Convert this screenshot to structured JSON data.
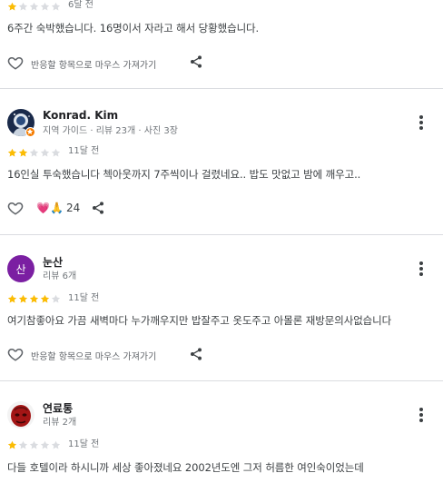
{
  "reviews": [
    {
      "rating": 1,
      "date": "6달 전",
      "text": "6주간 숙박했습니다. 16명이서 자라고 해서 당황했습니다.",
      "react_label": "반응할 항목으로 마우스 가져가기"
    },
    {
      "name": "Konrad. Kim",
      "sub": "지역 가이드 · 리뷰 23개 · 사진 3장",
      "avatar_icon": "astronaut-avatar-icon",
      "rating": 2,
      "date": "11달 전",
      "text": "16인실 투숙했습니다 첵아웃까지 7주씩이나 걸렸네요.. 밥도 맛없고 밤에 깨우고..",
      "reactions": "💗🙏",
      "reaction_count": "24"
    },
    {
      "name": "눈산",
      "sub": "리뷰 6개",
      "avatar_letter": "산",
      "avatar_color": "#7b1fa2",
      "rating": 4,
      "date": "11달 전",
      "text": "여기참좋아요 가끔 새벽마다 누가깨우지만 밥잘주고 옷도주고 아몰론 재방문의사없습니다",
      "react_label": "반응할 항목으로 마우스 가져가기"
    },
    {
      "name": "연료통",
      "sub": "리뷰 2개",
      "avatar_icon": "red-mask-avatar-icon",
      "rating": 1,
      "date": "11달 전",
      "text": "다들 호텔이라 하시니까 세상 좋아졌네요 2002년도엔 그저 허름한 여인숙이었는데"
    }
  ],
  "colors": {
    "star_filled": "#fbbc04",
    "star_empty": "#dadce0",
    "divider": "#dadce0"
  }
}
